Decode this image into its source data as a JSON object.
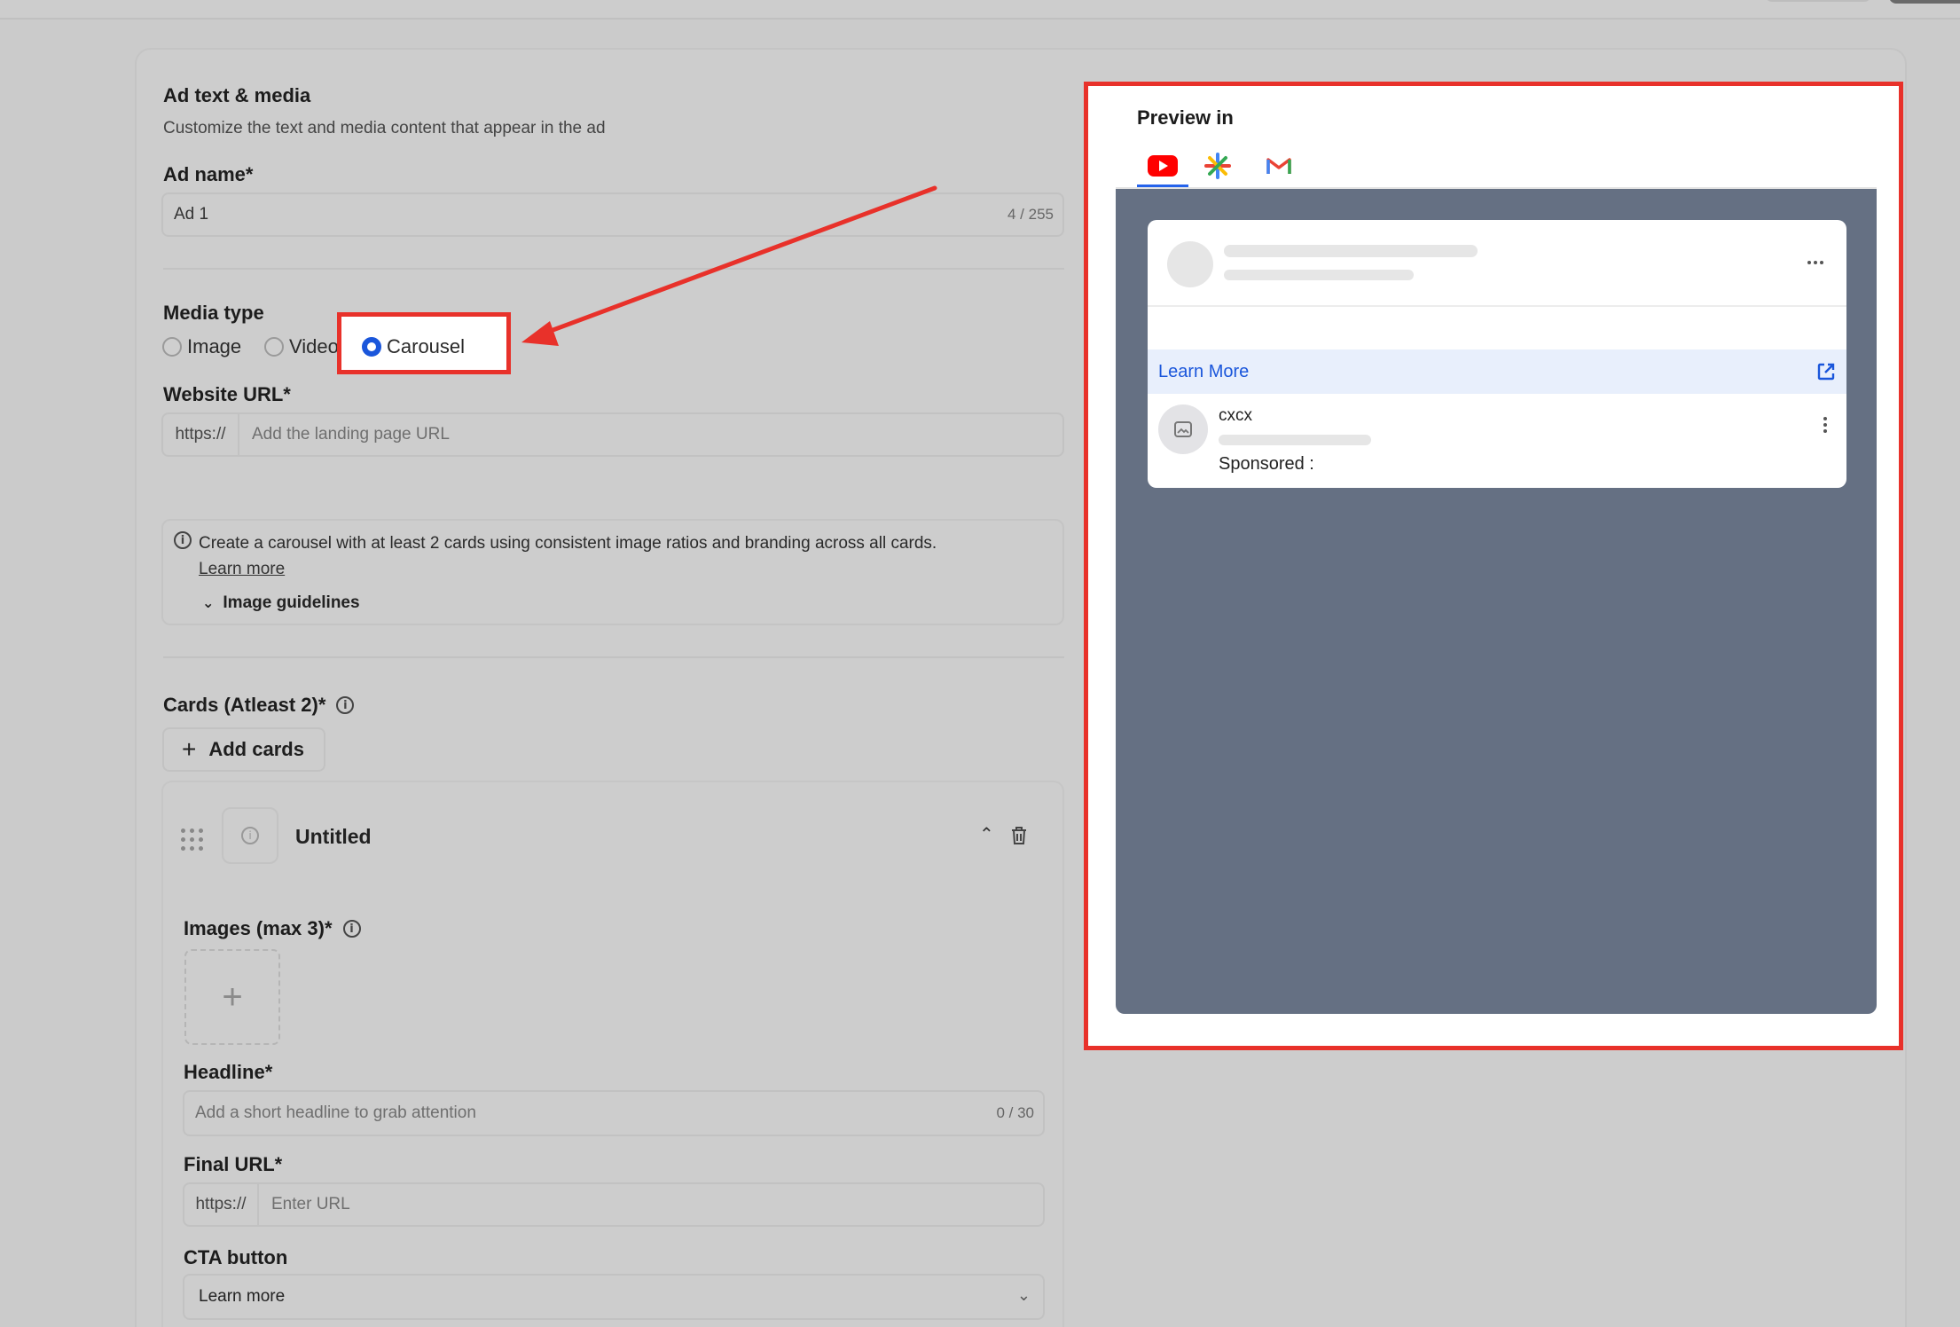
{
  "ad_section": {
    "title": "Ad text & media",
    "subtitle": "Customize the text and media content that appear in the ad"
  },
  "ad_name": {
    "label": "Ad name*",
    "value": "Ad 1",
    "counter": "4 / 255"
  },
  "media_type": {
    "label": "Media type",
    "options": [
      "Image",
      "Video",
      "Carousel"
    ],
    "selected": "Carousel"
  },
  "website_url": {
    "label": "Website URL*",
    "prefix": "https://",
    "placeholder": "Add the landing page URL"
  },
  "info_box": {
    "text": "Create a carousel with at least 2 cards using consistent image ratios and branding across all cards.",
    "link": "Learn more",
    "guidelines": "Image guidelines"
  },
  "cards": {
    "label": "Cards (Atleast 2)*",
    "add_button": "Add cards",
    "item_title": "Untitled"
  },
  "images": {
    "label": "Images (max 3)*"
  },
  "headline": {
    "label": "Headline*",
    "placeholder": "Add a short headline to grab attention",
    "counter": "0 / 30"
  },
  "final_url": {
    "label": "Final URL*",
    "prefix": "https://",
    "placeholder": "Enter URL"
  },
  "cta": {
    "label": "CTA button",
    "value": "Learn more"
  },
  "preview": {
    "title": "Preview in",
    "tabs": [
      "youtube-icon",
      "google-icon",
      "gmail-icon"
    ],
    "learn_more": "Learn More",
    "advertiser": "cxcx",
    "sponsored": "Sponsored :"
  },
  "colors": {
    "highlight": "#e8312a",
    "accent": "#1a56db",
    "preview_bg": "#657083"
  }
}
